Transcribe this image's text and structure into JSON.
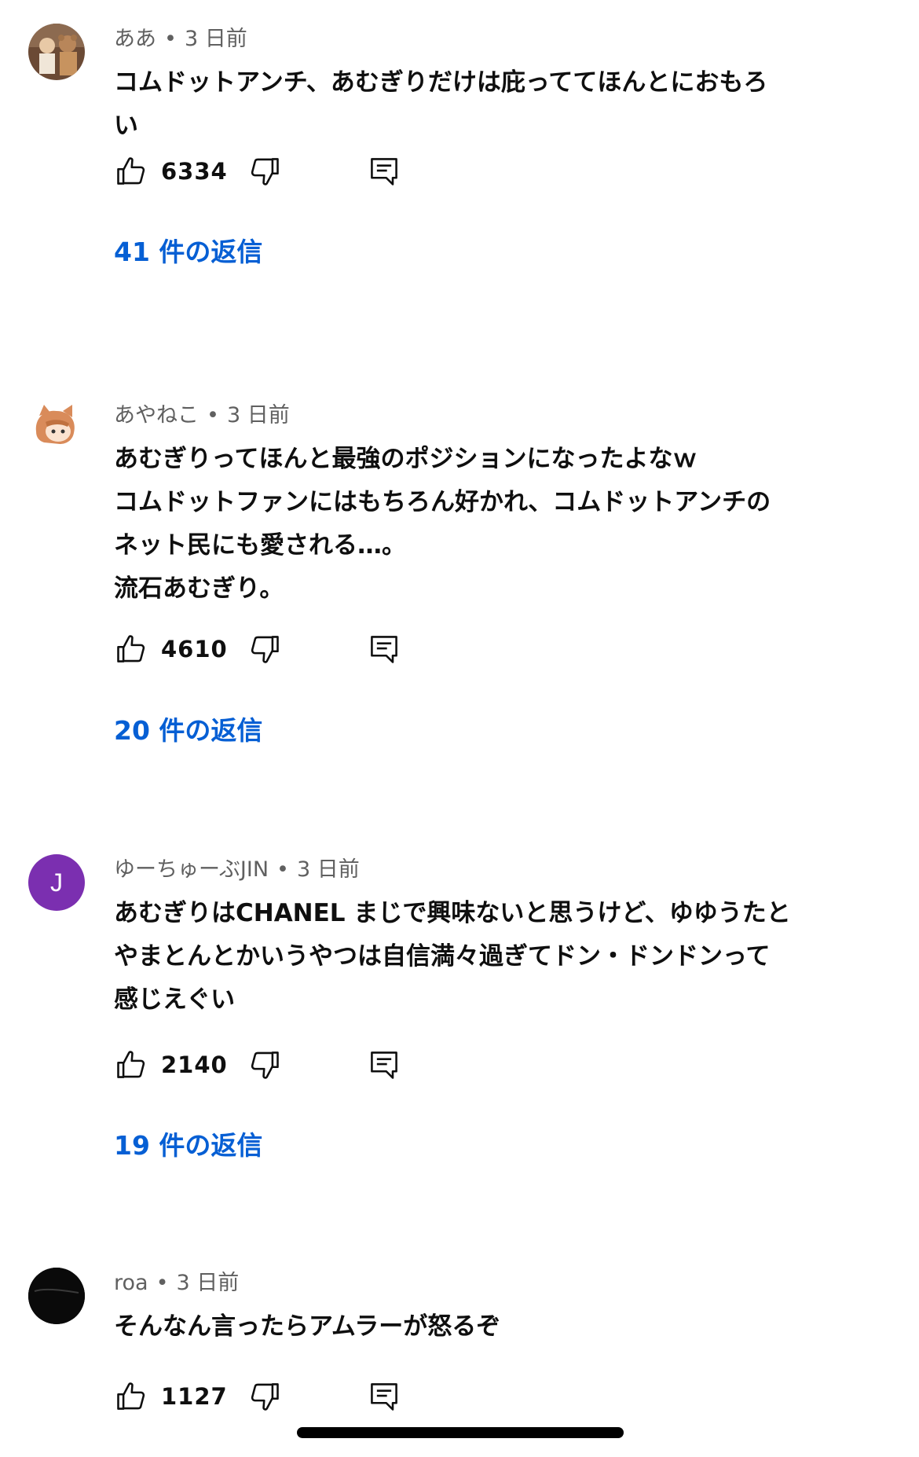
{
  "comments": [
    {
      "author": "ああ",
      "time": "3 日前",
      "avatar_type": "photo",
      "lines": [
        "コムドットアンチ、あむぎりだけは庇っててほんとにおもろ",
        "い"
      ],
      "likes": "6334",
      "replies": "41 件の返信"
    },
    {
      "author": "あやねこ",
      "time": "3 日前",
      "avatar_type": "illustration",
      "lines": [
        "あむぎりってほんと最強のポジションになったよなｗ",
        "コムドットファンにはもちろん好かれ、コムドットアンチの",
        "ネット民にも愛される…。",
        "流石あむぎり。"
      ],
      "likes": "4610",
      "replies": "20 件の返信"
    },
    {
      "author": "ゆーちゅーぶJIN",
      "time": "3 日前",
      "avatar_type": "letter",
      "avatar_letter": "J",
      "avatar_color": "#7b2fb0",
      "lines": [
        "あむぎりはCHANEL まじで興味ないと思うけど、ゆゆうたと",
        "やまとんとかいうやつは自信満々過ぎてドン・ドンドンって",
        "感じえぐい"
      ],
      "likes": "2140",
      "replies": "19 件の返信"
    },
    {
      "author": "roa",
      "time": "3 日前",
      "avatar_type": "dark",
      "lines": [
        "そんなん言ったらアムラーが怒るぞ"
      ],
      "likes": "1127",
      "replies": ""
    }
  ],
  "separator": "•",
  "icons": {
    "like": "thumb-up-icon",
    "dislike": "thumb-down-icon",
    "reply": "reply-icon"
  },
  "colors": {
    "link": "#065fd4",
    "meta": "#606060",
    "text": "#0f0f0f"
  }
}
